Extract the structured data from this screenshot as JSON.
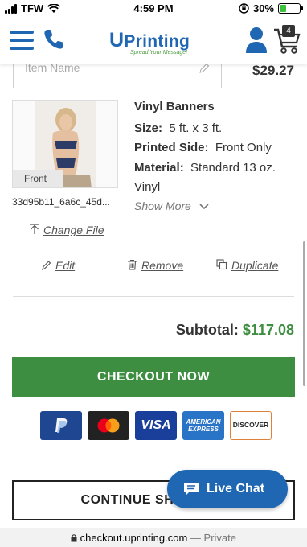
{
  "status_bar": {
    "carrier": "TFW",
    "time": "4:59 PM",
    "battery": "30%"
  },
  "header": {
    "logo_u": "U",
    "logo_text": "Printing",
    "logo_tagline": "Spread Your Message!",
    "cart_count": "4",
    "brand_blue": "#1f67b3",
    "brand_green": "#3e8e41"
  },
  "item": {
    "name_placeholder": "Item Name",
    "price": "$29.27",
    "thumbnail_label": "Front",
    "file_name": "33d95b11_6a6c_45d...",
    "title": "Vinyl Banners",
    "specs": [
      {
        "label": "Size:",
        "value": "5 ft. x 3 ft."
      },
      {
        "label": "Printed Side:",
        "value": "Front Only"
      },
      {
        "label": "Material:",
        "value": "Standard 13 oz."
      }
    ],
    "material_cont": "Vinyl",
    "show_more": "Show More",
    "change_file": "Change File",
    "actions": {
      "edit": "Edit",
      "remove": "Remove",
      "duplicate": "Duplicate"
    }
  },
  "summary": {
    "subtotal_label": "Subtotal:",
    "subtotal_value": "$117.08",
    "checkout_label": "CHECKOUT NOW",
    "continue_label": "CONTINUE SHOPPING"
  },
  "payments": [
    "paypal",
    "mastercard",
    "VISA",
    "AMERICAN EXPRESS",
    "DISCOVER"
  ],
  "live_chat": "Live Chat",
  "url_bar": {
    "domain": "checkout.uprinting.com",
    "mode": "— Private"
  }
}
